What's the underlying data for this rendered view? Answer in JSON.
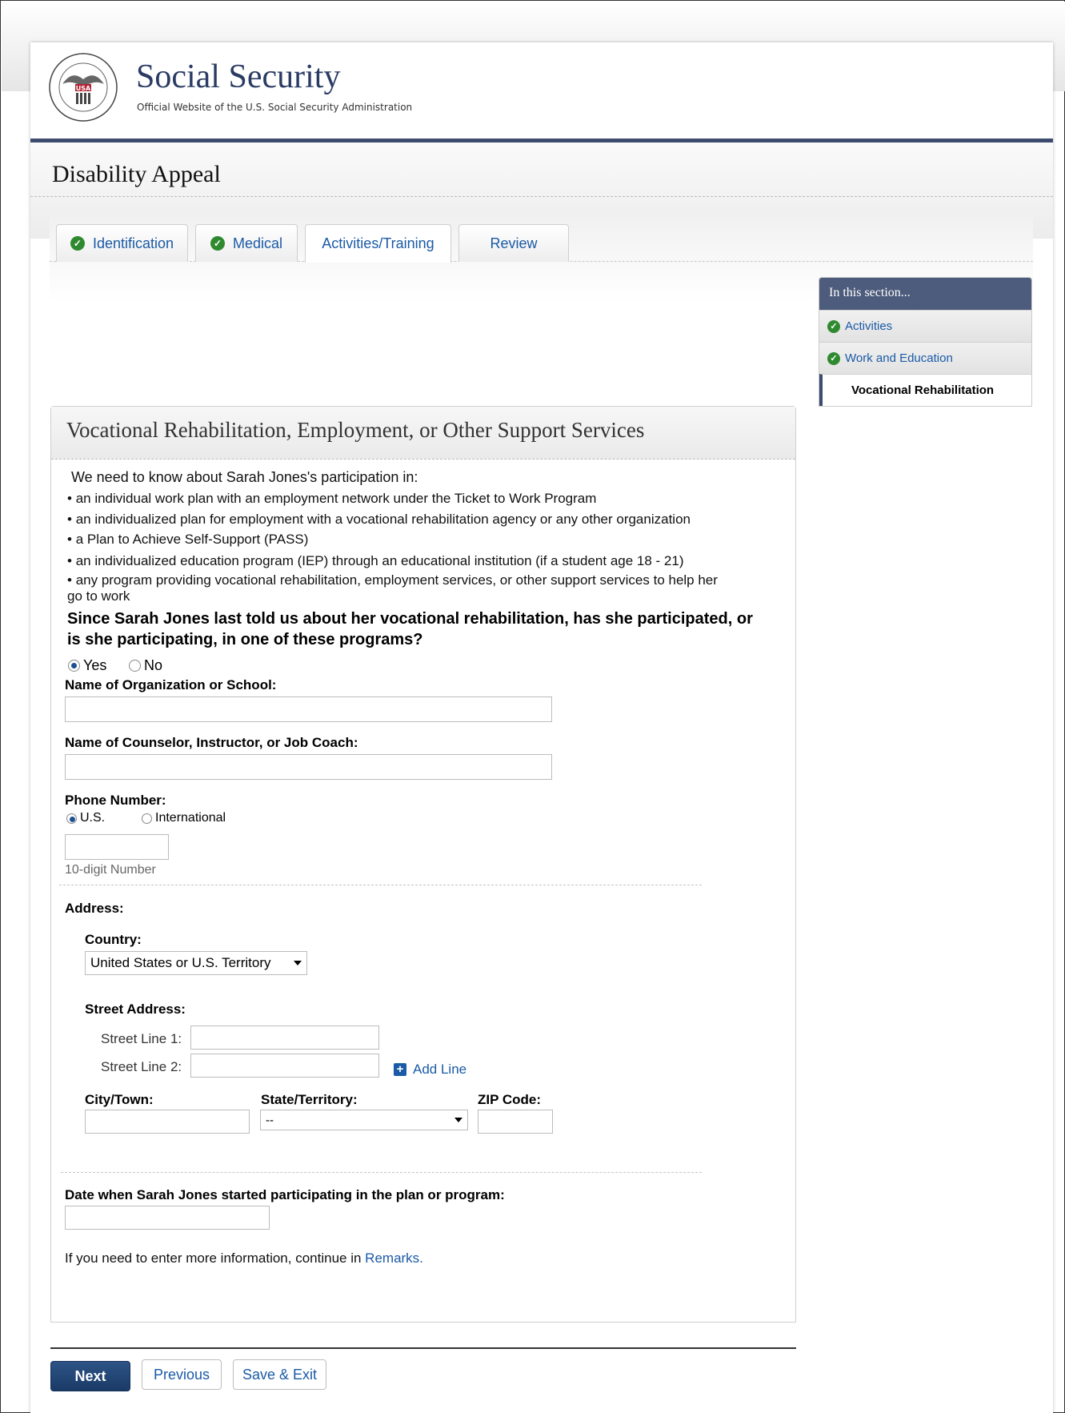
{
  "header": {
    "brand_title": "Social Security",
    "brand_subtitle": "Official Website of the U.S. Social Security Administration",
    "seal_text": "SOCIAL SECURITY ADMINISTRATION USA"
  },
  "page_title": "Disability Appeal",
  "tabs": [
    {
      "label": "Identification",
      "completed": true
    },
    {
      "label": "Medical",
      "completed": true
    },
    {
      "label": "Activities/Training",
      "completed": false,
      "active": true
    },
    {
      "label": "Review",
      "completed": false
    }
  ],
  "sidebar": {
    "heading": "In this section...",
    "items": [
      {
        "label": "Activities",
        "completed": true
      },
      {
        "label": "Work and Education",
        "completed": true
      },
      {
        "label": "Vocational Rehabilitation",
        "current": true
      }
    ]
  },
  "section": {
    "title": "Vocational Rehabilitation, Employment, or Other Support Services",
    "intro": "We need to know about Sarah Jones's participation in:",
    "bullets": [
      "an individual work plan with an employment network under the Ticket to Work Program",
      "an individualized plan for employment with a vocational rehabilitation agency or any other organization",
      "a Plan to Achieve Self-Support (PASS)",
      "an individualized education program (IEP) through an educational institution (if a student age 18 - 21)",
      "any program providing vocational rehabilitation, employment services, or other support services to help her go to work"
    ],
    "question": "Since Sarah Jones last told us about her vocational rehabilitation, has she participated, or is she participating, in one of these programs?",
    "answer_yes": "Yes",
    "answer_no": "No",
    "answer_selected": "Yes"
  },
  "form": {
    "org_label": "Name of Organization or School:",
    "org_value": "",
    "counselor_label": "Name of Counselor, Instructor, or Job Coach:",
    "counselor_value": "",
    "phone_label": "Phone Number:",
    "phone_us": "U.S.",
    "phone_intl": "International",
    "phone_selected": "U.S.",
    "phone_value": "",
    "phone_hint": "10-digit Number",
    "address_label": "Address:",
    "country_label": "Country:",
    "country_value": "United States or U.S. Territory",
    "street_label": "Street Address:",
    "street1_label": "Street Line 1:",
    "street2_label": "Street Line 2:",
    "add_line": "Add Line",
    "city_label": "City/Town:",
    "state_label": "State/Territory:",
    "state_value": "--",
    "zip_label": "ZIP Code:",
    "date_label": "Date when Sarah Jones started participating in the plan or program:",
    "date_value": "",
    "remarks_prefix": "If you need to enter more information, continue in ",
    "remarks_link": "Remarks."
  },
  "buttons": {
    "next": "Next",
    "previous": "Previous",
    "save_exit": "Save & Exit"
  },
  "colors": {
    "brand": "#2a3b63",
    "link": "#1a5aa6",
    "check": "#2f8a2f",
    "primary_button": "#1a3a66"
  }
}
